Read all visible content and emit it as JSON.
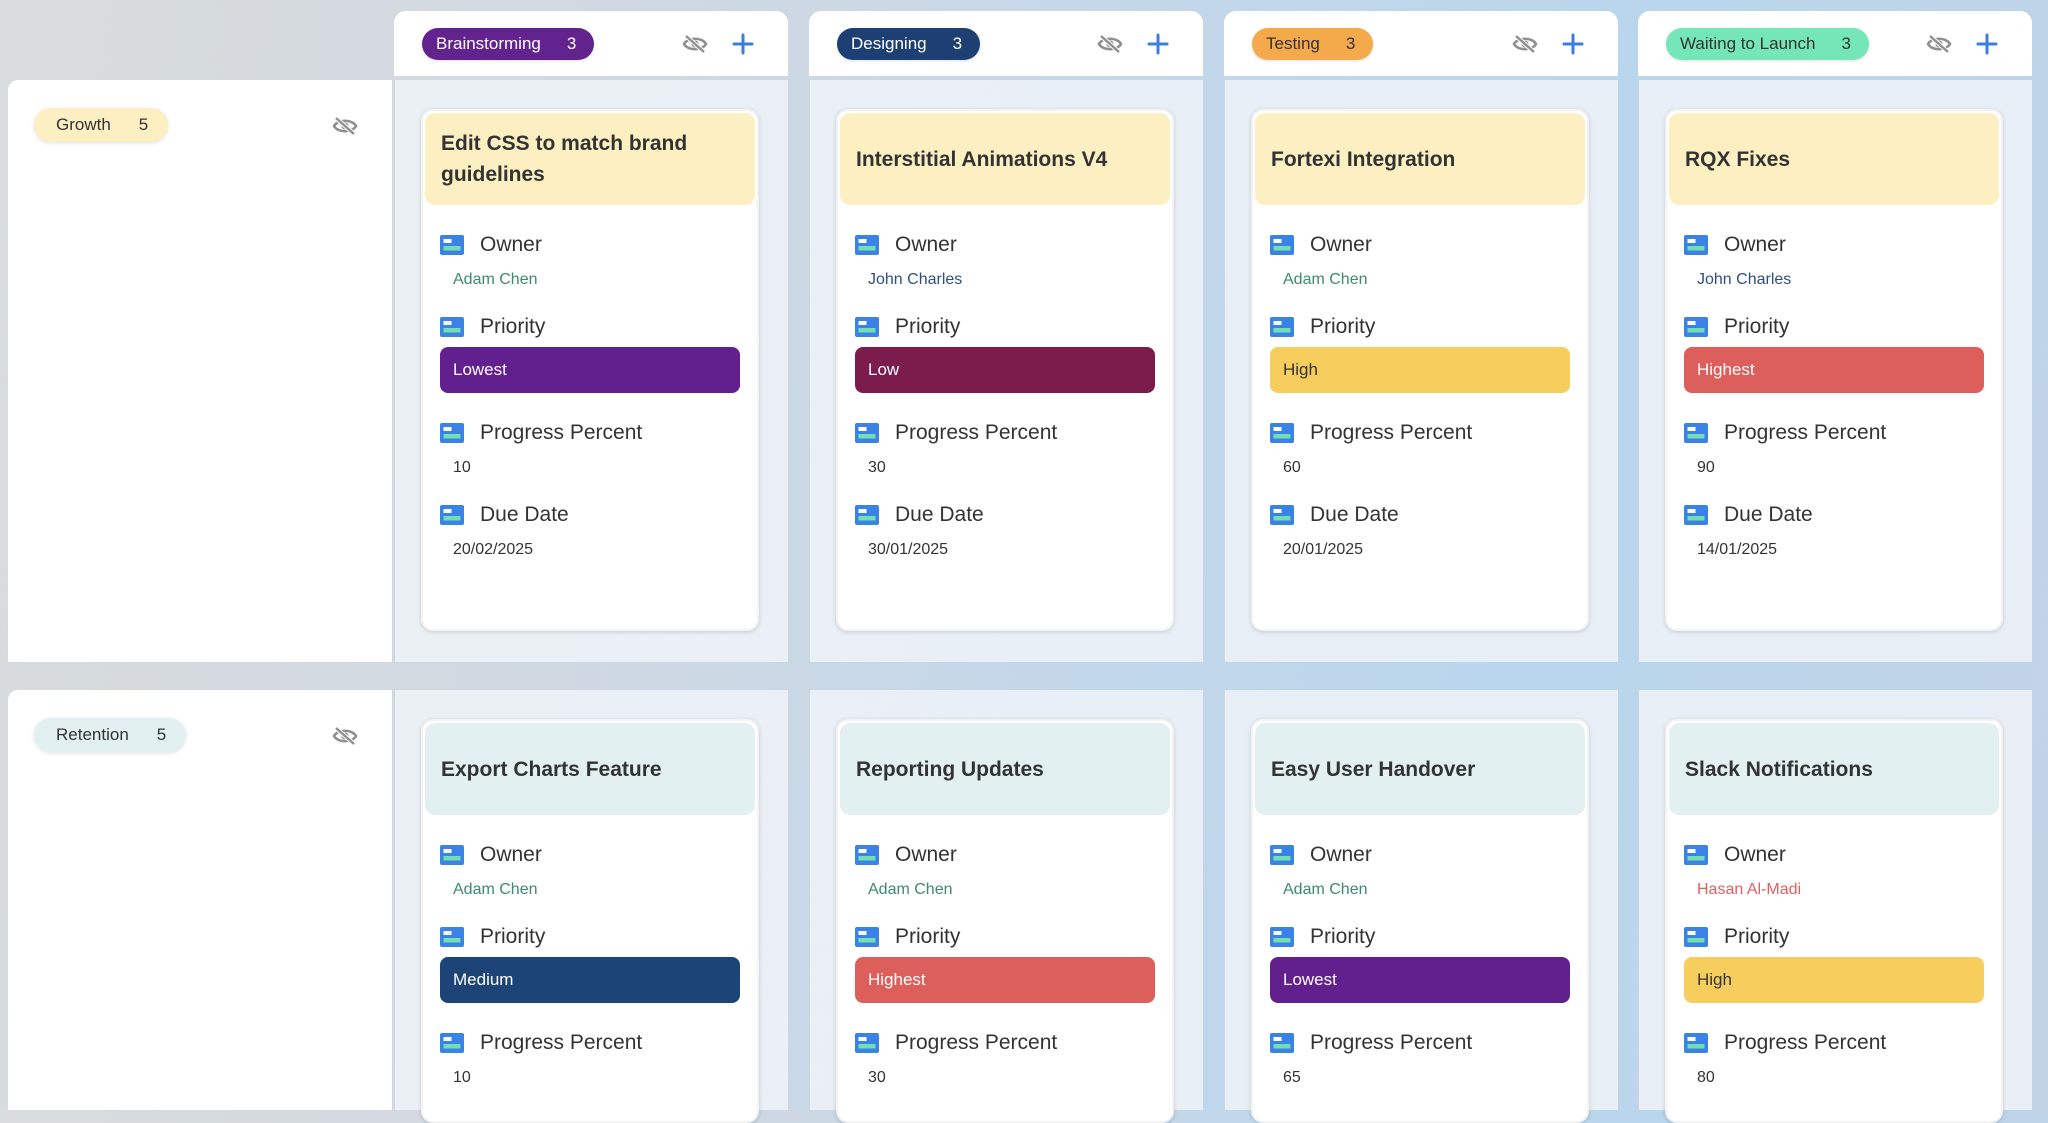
{
  "columns": [
    {
      "label": "Brainstorming",
      "count": "3",
      "pill_bg": "#62238f",
      "pill_fg": "#ffffff"
    },
    {
      "label": "Designing",
      "count": "3",
      "pill_bg": "#1d3f73",
      "pill_fg": "#ffffff"
    },
    {
      "label": "Testing",
      "count": "3",
      "pill_bg": "#f4a94b",
      "pill_fg": "#333333"
    },
    {
      "label": "Waiting to Launch",
      "count": "3",
      "pill_bg": "#75e6b7",
      "pill_fg": "#333333"
    }
  ],
  "groups": [
    {
      "label": "Growth",
      "count": "5",
      "pill_bg": "#fcefc2",
      "title_style": "yellow",
      "cards": [
        {
          "title": "Edit CSS to match brand guidelines",
          "owner": "Adam Chen",
          "owner_color": "#3d8a6e",
          "priority": "Lowest",
          "priority_bg": "#62208f",
          "priority_fg": "#ffffff",
          "progress": "10",
          "due": "20/02/2025"
        },
        {
          "title": "Interstitial Animations V4",
          "owner": "John Charles",
          "owner_color": "#2f4f80",
          "priority": "Low",
          "priority_bg": "#7b1c4c",
          "priority_fg": "#ffffff",
          "progress": "30",
          "due": "30/01/2025"
        },
        {
          "title": "Fortexi Integration",
          "owner": "Adam Chen",
          "owner_color": "#3d8a6e",
          "priority": "High",
          "priority_bg": "#f7ce5d",
          "priority_fg": "#333333",
          "progress": "60",
          "due": "20/01/2025"
        },
        {
          "title": "RQX Fixes",
          "owner": "John Charles",
          "owner_color": "#2f4f80",
          "priority": "Highest",
          "priority_bg": "#dd5f5b",
          "priority_fg": "#ffffff",
          "progress": "90",
          "due": "14/01/2025"
        }
      ]
    },
    {
      "label": "Retention",
      "count": "5",
      "pill_bg": "#e2f0f1",
      "title_style": "teal",
      "cards": [
        {
          "title": "Export Charts Feature",
          "owner": "Adam Chen",
          "owner_color": "#3d8a6e",
          "priority": "Medium",
          "priority_bg": "#1d4477",
          "priority_fg": "#ffffff",
          "progress": "10",
          "due": ""
        },
        {
          "title": "Reporting Updates",
          "owner": "Adam Chen",
          "owner_color": "#3d8a6e",
          "priority": "Highest",
          "priority_bg": "#dd5f5b",
          "priority_fg": "#ffffff",
          "progress": "30",
          "due": ""
        },
        {
          "title": "Easy User Handover",
          "owner": "Adam Chen",
          "owner_color": "#3d8a6e",
          "priority": "Lowest",
          "priority_bg": "#62208f",
          "priority_fg": "#ffffff",
          "progress": "65",
          "due": ""
        },
        {
          "title": "Slack Notifications",
          "owner": "Hasan Al-Madi",
          "owner_color": "#e0605f",
          "priority": "High",
          "priority_bg": "#f7ce5d",
          "priority_fg": "#333333",
          "progress": "80",
          "due": ""
        }
      ]
    }
  ],
  "field_labels": {
    "owner": "Owner",
    "priority": "Priority",
    "progress": "Progress Percent",
    "due": "Due Date"
  },
  "icons": {
    "hide": "eye-off-icon",
    "add": "plus-icon",
    "field": "field-card-icon"
  },
  "colors": {
    "accent": "#3b7de0",
    "icon_gray": "#8f8f8f"
  }
}
